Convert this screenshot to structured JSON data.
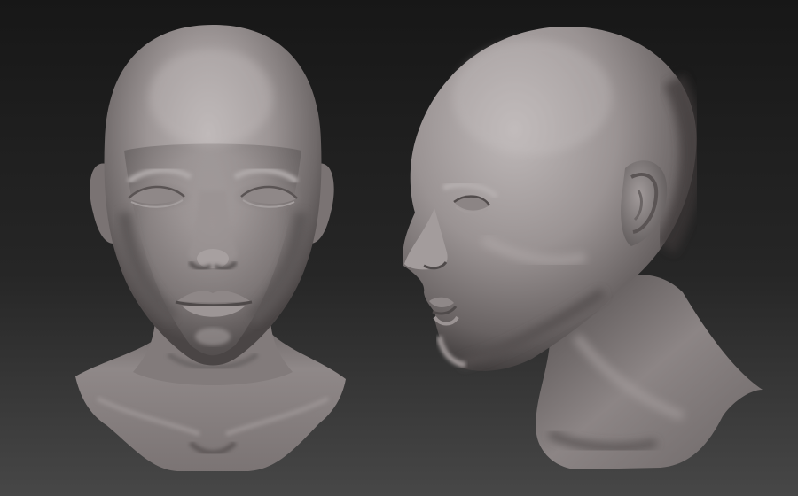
{
  "scene": {
    "subject": "sculpted-head-bust",
    "views": [
      {
        "name": "front-view"
      },
      {
        "name": "three-quarter-profile-view"
      }
    ]
  },
  "colors": {
    "background_top": "#1b1b1b",
    "background_bottom": "#444444",
    "clay_light": "#b9b3b3",
    "clay_mid": "#8a8383",
    "clay_dark": "#4a4545",
    "clay_shadow": "#2e2b2b"
  }
}
